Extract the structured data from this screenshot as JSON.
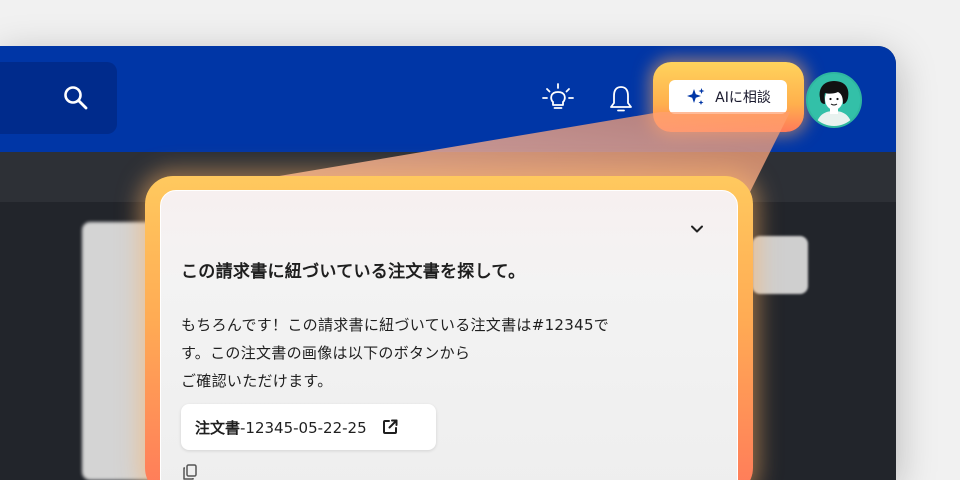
{
  "header": {
    "ai_button_label": "AIに相談",
    "accent_color": "#0036a6",
    "glow_colors": [
      "#ffd35c",
      "#ff7a5a"
    ]
  },
  "icons": {
    "search": "search-icon",
    "bulb": "lightbulb-icon",
    "bell": "bell-icon",
    "sparkle": "sparkle-icon",
    "avatar": "avatar",
    "collapse": "chevron-down-icon",
    "external": "external-link-icon",
    "copy": "copy-icon"
  },
  "chat": {
    "question": "この請求書に紐づいている注文書を探して。",
    "answer_lines": [
      "もちろんです！この請求書に紐づいている注文書は#12345で",
      "す。この注文書の画像は以下のボタンから",
      "ご確認いただけます。"
    ],
    "document_button": {
      "prefix": "注文書",
      "suffix": "-12345-05-22-25"
    }
  }
}
